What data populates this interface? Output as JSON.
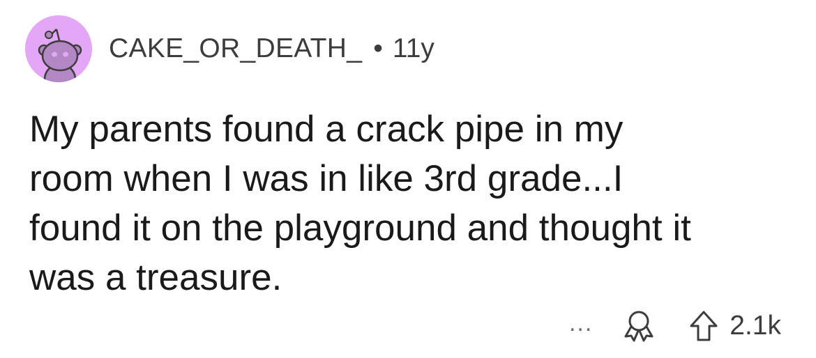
{
  "comment": {
    "author": "CAKE_OR_DEATH_",
    "separator": "•",
    "age": "11y",
    "body": "My parents found a crack pipe in my\nroom when I was in like 3rd grade...I\nfound it on the playground and thought it\nwas a treasure.",
    "avatar_color": "#e4a6f6",
    "more_label": "...",
    "score": "2.1k",
    "icons": {
      "avatar": "snoo-avatar-icon",
      "award": "award-icon",
      "upvote": "upvote-arrow-icon"
    }
  }
}
